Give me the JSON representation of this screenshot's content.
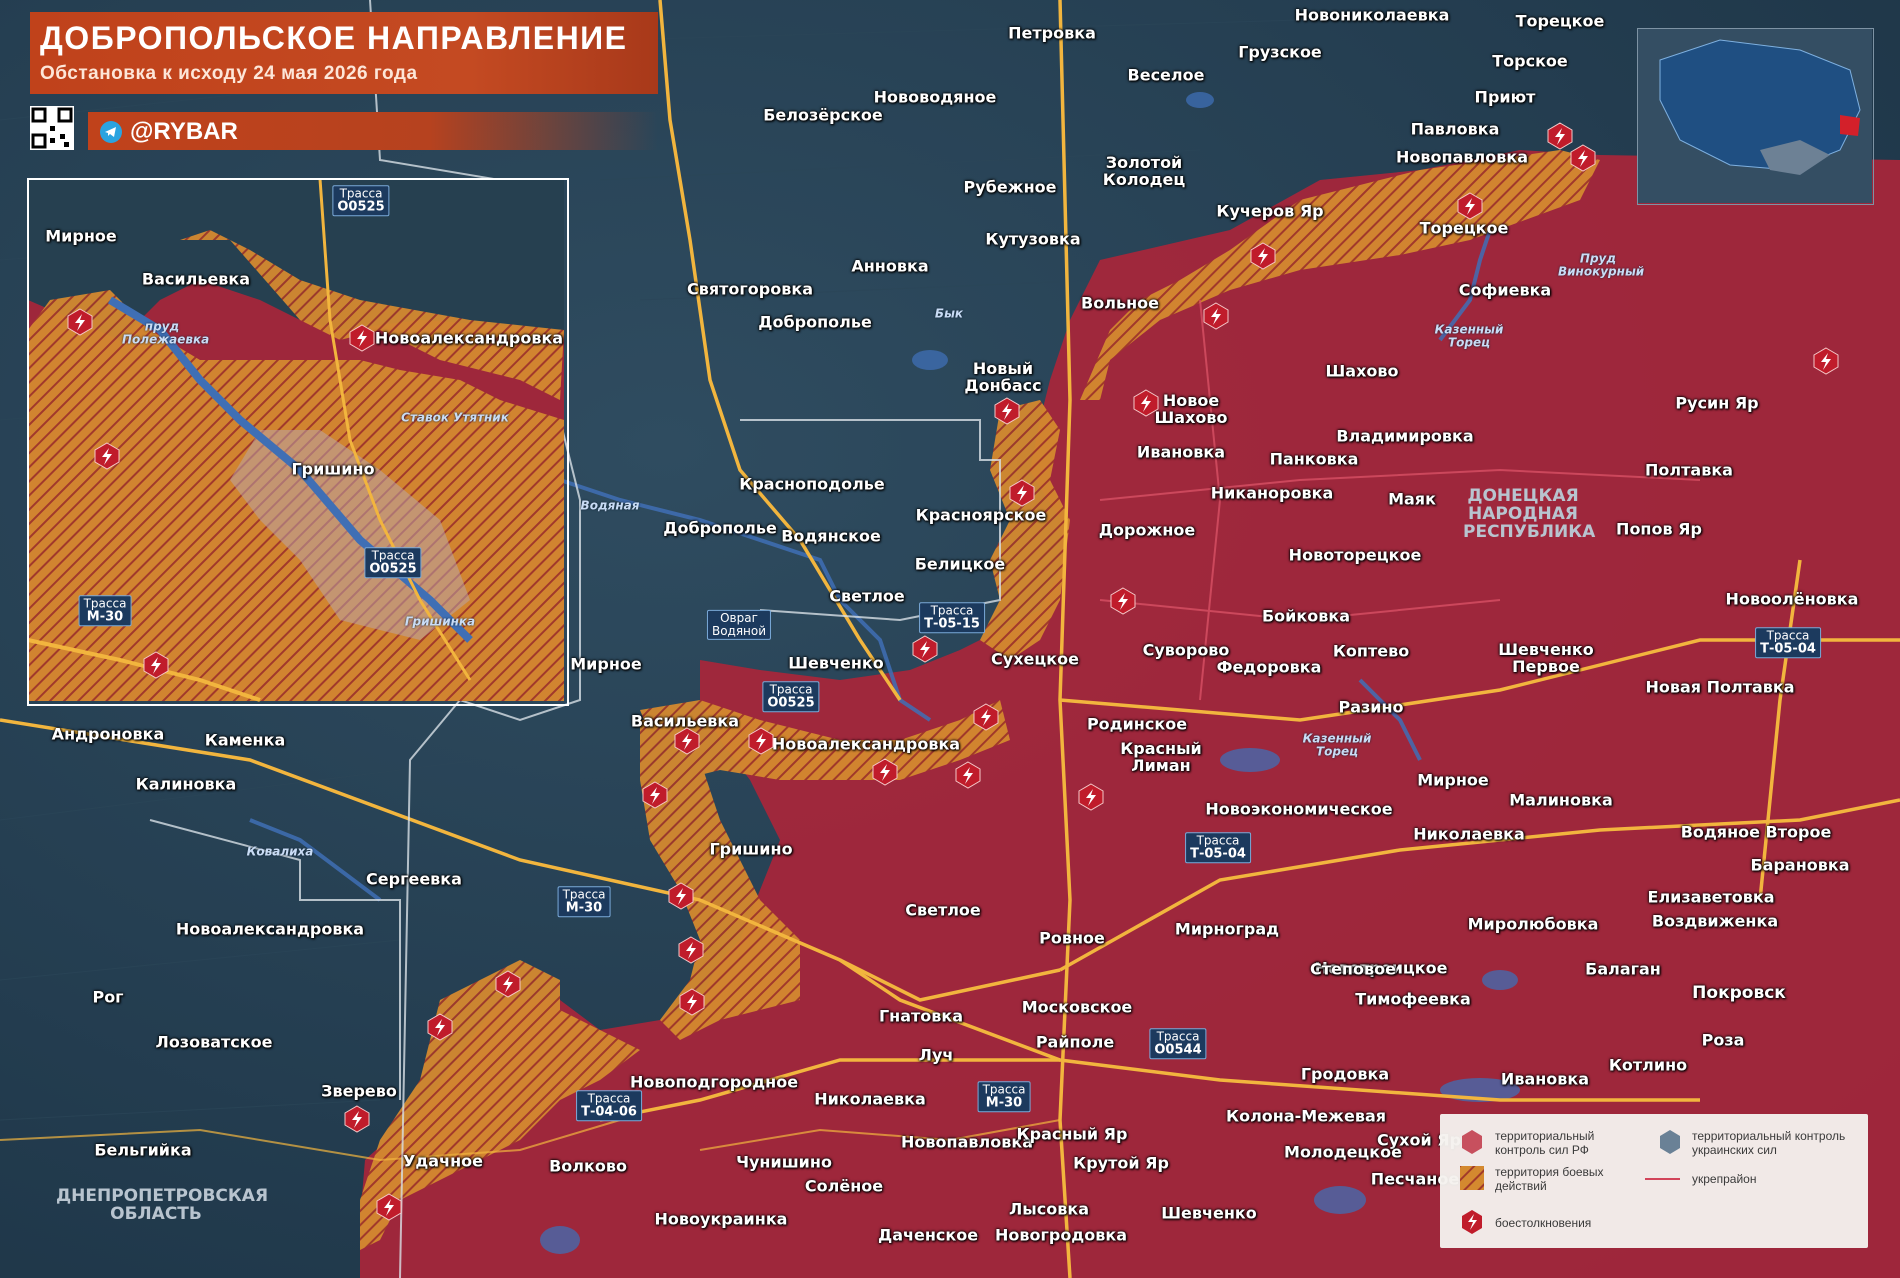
{
  "header": {
    "title": "ДОБРОПОЛЬСКОЕ НАПРАВЛЕНИЕ",
    "subtitle": "Обстановка к исходу 24 мая 2026 года",
    "brand": "@RYBAR"
  },
  "colors": {
    "ru_control": "#a8263a",
    "combat_zone": "#e59a38",
    "ua_control": "#3a5670",
    "road": "#f2b53e",
    "header": "#c0421b",
    "fortline": "#e0566a"
  },
  "legend": {
    "ru": "территориальный контроль сил РФ",
    "ua": "территориальный контроль украинских сил",
    "combat": "территория боевых действий",
    "fort": "укрепрайон",
    "clash": "боестолкновения"
  },
  "regions": {
    "dnr": "ДОНЕЦКАЯ НАРОДНАЯ РЕСПУБЛИКА",
    "dnepr": "ДНЕПРОПЕТРОВСКАЯ ОБЛАСТЬ"
  },
  "roads": [
    {
      "name": "Трасса",
      "code": "О0525"
    },
    {
      "name": "Трасса",
      "code": "О0525"
    },
    {
      "name": "Трасса",
      "code": "М-30"
    },
    {
      "name": "Трасса",
      "code": "Т-05-15"
    },
    {
      "name": "Трасса",
      "code": "О0525"
    },
    {
      "name": "Трасса",
      "code": "М-30"
    },
    {
      "name": "Трасса",
      "code": "Т-05-04"
    },
    {
      "name": "Трасса",
      "code": "О0544"
    },
    {
      "name": "Трасса",
      "code": "М-30"
    },
    {
      "name": "Трасса",
      "code": "Т-04-06"
    },
    {
      "name": "Трасса",
      "code": "Т-05-04"
    }
  ],
  "water": [
    "пруд Полежаевка",
    "Ставок Утятник",
    "Гришинка",
    "Водяная",
    "Бык",
    "Казенный Торец",
    "Казенный Торец",
    "Пруд Винокурный",
    "Ковалиха"
  ],
  "inset_towns": [
    "Мирное",
    "Васильевка",
    "Новоалександровка",
    "Гришино"
  ],
  "towns": [
    "Новониколаевка",
    "Торецкое",
    "Петровка",
    "Грузское",
    "Торское",
    "Веселое",
    "Нововодяное",
    "Белозёрское",
    "Приют",
    "Павловка",
    "Новопавловка",
    "Золотой Колодец",
    "Рубежное",
    "Кучеров Яр",
    "Торецкое",
    "Кутузовка",
    "Анновка",
    "Святогоровка",
    "Софиевка",
    "Доброполье",
    "Вольное",
    "Новый Донбасс",
    "Шахово",
    "Новое Шахово",
    "Русин Яр",
    "Владимировка",
    "Ивановка",
    "Панковка",
    "Полтавка",
    "Красноподолье",
    "Никаноровка",
    "Маяк",
    "Доброполье",
    "Водянское",
    "Красноярское",
    "Дорожное",
    "Попов Яр",
    "Белицкое",
    "Новоторецкое",
    "Светлое",
    "Бойковка",
    "Новоолёновка",
    "Шевченко",
    "Сухецкое",
    "Суворово",
    "Федоровка",
    "Коптево",
    "Шевченко Первое",
    "Мирное",
    "Новая Полтавка",
    "Разино",
    "Андроновка",
    "Каменка",
    "Васильевка",
    "Новоалександровка",
    "Родинское",
    "Красный Лиман",
    "Калиновка",
    "Мирное",
    "Малиновка",
    "Новоэкономическое",
    "Николаевка",
    "Водяное Второе",
    "Гришино",
    "Барановка",
    "Сергеевка",
    "Елизаветовка",
    "Светлое",
    "Мирноград",
    "Миролюбовка",
    "Воздвиженка",
    "Новоалександровка",
    "Ровное",
    "Новотроицкое",
    "Балаган",
    "Степовое",
    "Рог",
    "Московское",
    "Тимофеевка",
    "Покровск",
    "Гнатовка",
    "Райполе",
    "Лозоватское",
    "Роза",
    "Луч",
    "Гродовка",
    "Ивановка",
    "Котлино",
    "Новоподгородное",
    "Зверево",
    "Николаевка",
    "Колона-Межевая",
    "Бельгийка",
    "Новопавловка",
    "Красный Яр",
    "Сухой Яр",
    "Молодецкое",
    "Удачное",
    "Волково",
    "Чунишино",
    "Крутой Яр",
    "Песчаное",
    "Солёное",
    "Новоукраинка",
    "Лысовка",
    "Шевченко",
    "Даченское",
    "Новогродовка"
  ]
}
